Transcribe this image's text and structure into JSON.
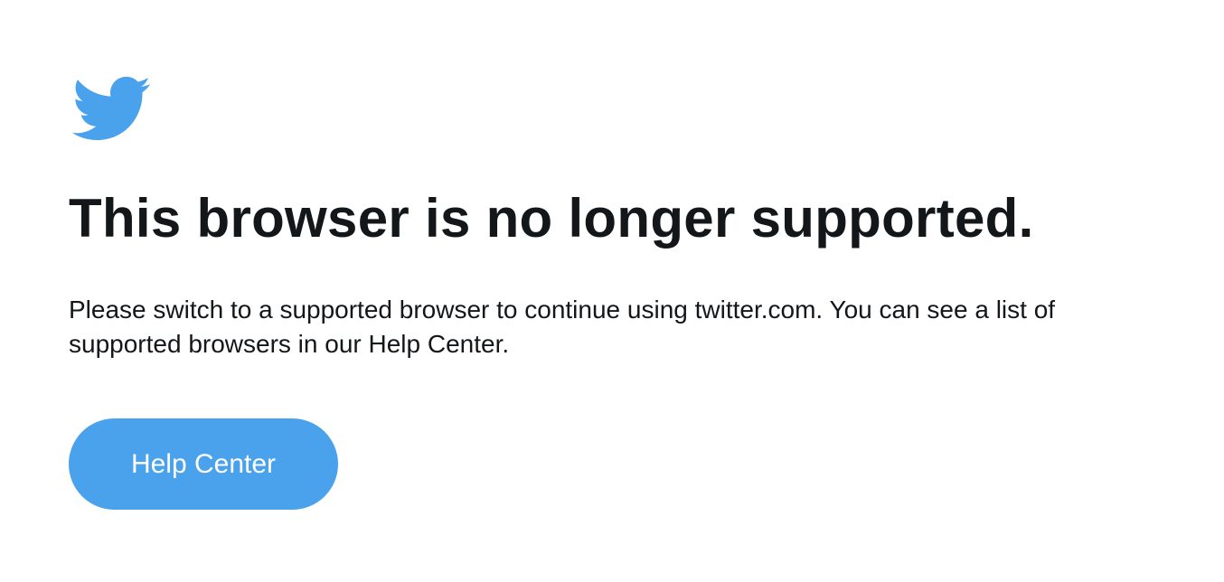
{
  "brand": {
    "logo_icon": "twitter-bird-icon",
    "color": "#4aa1ec"
  },
  "headline": "This browser is no longer supported.",
  "message": "Please switch to a supported browser to continue using twitter.com. You can see a list of supported browsers in our Help Center.",
  "help_button": {
    "label": "Help Center"
  }
}
